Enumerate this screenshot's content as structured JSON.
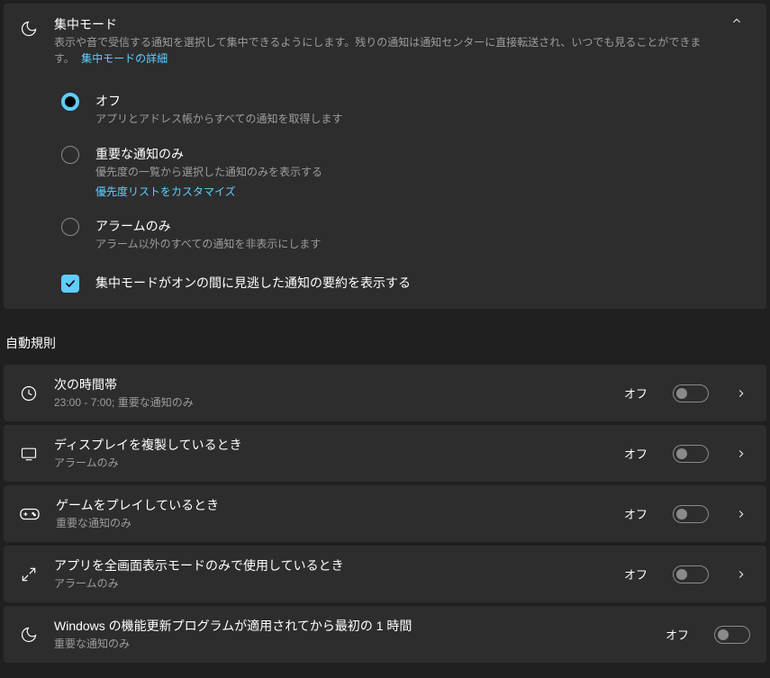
{
  "focus": {
    "title": "集中モード",
    "desc": "表示や音で受信する通知を選択して集中できるようにします。残りの通知は通知センターに直接転送され、いつでも見ることができます。",
    "learn_more": "集中モードの詳細",
    "options": {
      "off": {
        "label": "オフ",
        "desc": "アプリとアドレス帳からすべての通知を取得します",
        "checked": true
      },
      "priority": {
        "label": "重要な通知のみ",
        "desc": "優先度の一覧から選択した通知のみを表示する",
        "link": "優先度リストをカスタマイズ",
        "checked": false
      },
      "alarms": {
        "label": "アラームのみ",
        "desc": "アラーム以外のすべての通知を非表示にします",
        "checked": false
      }
    },
    "summary_checkbox": {
      "label": "集中モードがオンの間に見逃した通知の要約を表示する",
      "checked": true
    }
  },
  "rules_heading": "自動規則",
  "rules": {
    "time": {
      "title": "次の時間帯",
      "desc": "23:00 - 7:00; 重要な通知のみ",
      "state": "オフ"
    },
    "display": {
      "title": "ディスプレイを複製しているとき",
      "desc": "アラームのみ",
      "state": "オフ"
    },
    "game": {
      "title": "ゲームをプレイしているとき",
      "desc": "重要な通知のみ",
      "state": "オフ"
    },
    "fullscreen": {
      "title": "アプリを全画面表示モードのみで使用しているとき",
      "desc": "アラームのみ",
      "state": "オフ"
    },
    "update": {
      "title": "Windows の機能更新プログラムが適用されてから最初の 1 時間",
      "desc": "重要な通知のみ",
      "state": "オフ"
    }
  }
}
